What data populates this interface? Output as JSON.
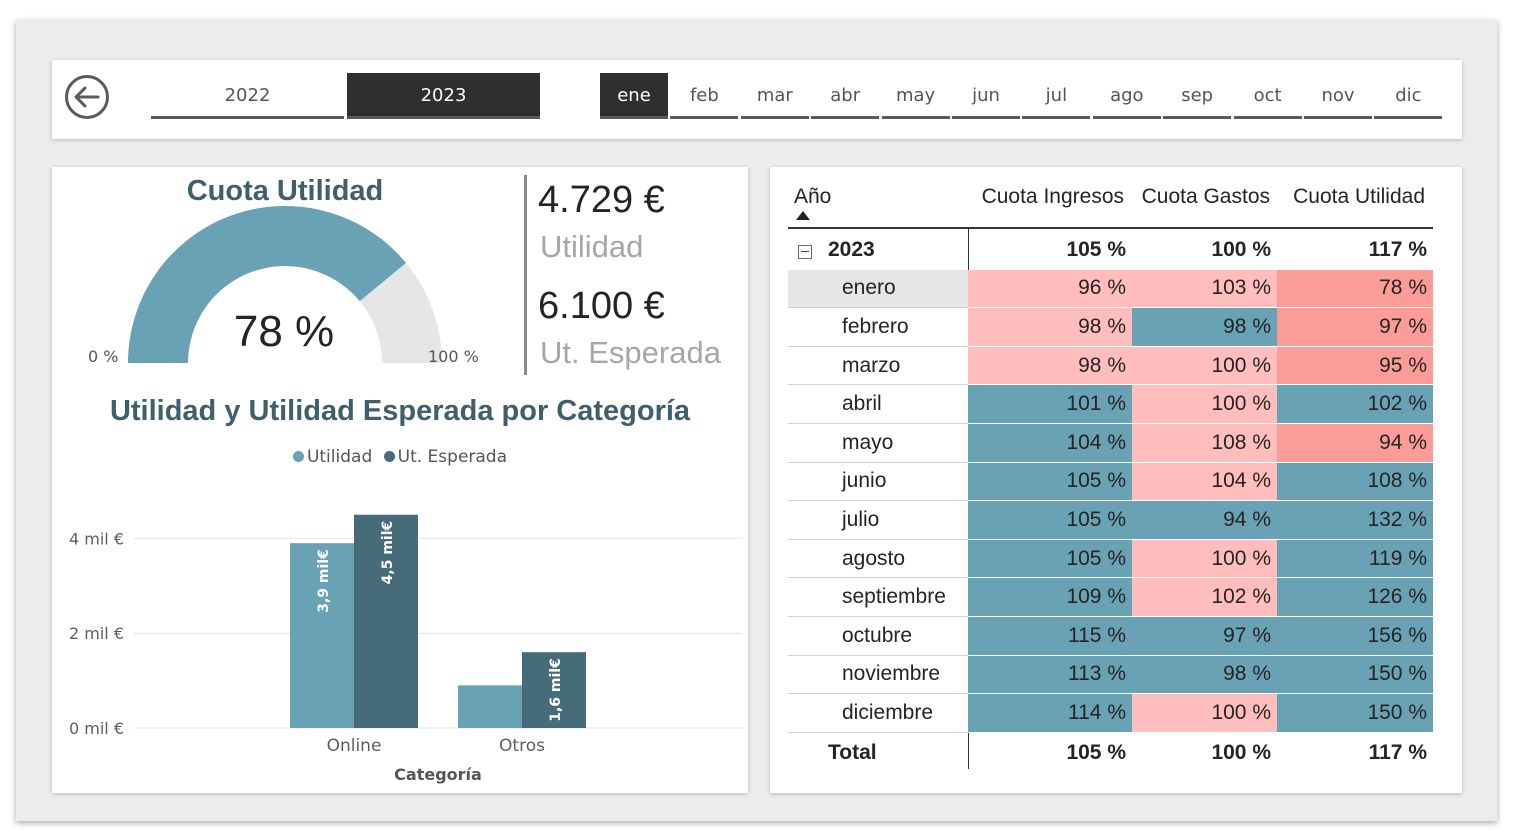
{
  "colors": {
    "teal": "#68a2b4",
    "dark_teal": "#476c79",
    "pink": "#ffbdbe",
    "red": "#fc9c99",
    "title": "#3f5f6c",
    "gauge_bg": "#e6e6e6",
    "selected": "#2f2f2f"
  },
  "filters": {
    "back_icon": "arrow-left-circle-icon",
    "years": [
      "2022",
      "2023"
    ],
    "selected_year": "2023",
    "months": [
      "ene",
      "feb",
      "mar",
      "abr",
      "may",
      "jun",
      "jul",
      "ago",
      "sep",
      "oct",
      "nov",
      "dic"
    ],
    "selected_month": "ene"
  },
  "gauge": {
    "title": "Cuota Utilidad",
    "value": 0.78,
    "value_label": "78 %",
    "min_label": "0 %",
    "max_label": "100 %"
  },
  "kpis": [
    {
      "value": "4.729 €",
      "label": "Utilidad"
    },
    {
      "value": "6.100 €",
      "label": "Ut. Esperada"
    }
  ],
  "chart_data": {
    "type": "bar",
    "title": "Utilidad y Utilidad Esperada por Categoría",
    "xlabel": "Categoría",
    "ylabel": "",
    "categories": [
      "Online",
      "Otros"
    ],
    "series": [
      {
        "name": "Utilidad",
        "values": [
          3.9,
          0.9
        ],
        "labels": [
          "3,9 mil€",
          ""
        ]
      },
      {
        "name": "Ut. Esperada",
        "values": [
          4.5,
          1.6
        ],
        "labels": [
          "4,5 mil€",
          "1,6 mil€"
        ]
      }
    ],
    "yticks": [
      0,
      2,
      4
    ],
    "ytick_labels": [
      "0 mil €",
      "2 mil €",
      "4 mil €"
    ],
    "ylim": [
      0,
      4.6
    ],
    "grid": true,
    "legend": "top-center"
  },
  "matrix": {
    "header": {
      "year": "Año",
      "c1": "Cuota Ingresos",
      "c2": "Cuota Gastos",
      "c3": "Cuota Utilidad"
    },
    "year_row": {
      "label": "2023",
      "c1": "105 %",
      "c2": "100 %",
      "c3": "117 %"
    },
    "rows": [
      {
        "label": "enero",
        "c1": "96 %",
        "c2": "103 %",
        "c3": "78 %",
        "k1": "pink",
        "k2": "pink",
        "k3": "red"
      },
      {
        "label": "febrero",
        "c1": "98 %",
        "c2": "98 %",
        "c3": "97 %",
        "k1": "pink",
        "k2": "teal",
        "k3": "red"
      },
      {
        "label": "marzo",
        "c1": "98 %",
        "c2": "100 %",
        "c3": "95 %",
        "k1": "pink",
        "k2": "pink",
        "k3": "red"
      },
      {
        "label": "abril",
        "c1": "101 %",
        "c2": "100 %",
        "c3": "102 %",
        "k1": "teal",
        "k2": "pink",
        "k3": "teal"
      },
      {
        "label": "mayo",
        "c1": "104 %",
        "c2": "108 %",
        "c3": "94 %",
        "k1": "teal",
        "k2": "pink",
        "k3": "red"
      },
      {
        "label": "junio",
        "c1": "105 %",
        "c2": "104 %",
        "c3": "108 %",
        "k1": "teal",
        "k2": "pink",
        "k3": "teal"
      },
      {
        "label": "julio",
        "c1": "105 %",
        "c2": "94 %",
        "c3": "132 %",
        "k1": "teal",
        "k2": "teal",
        "k3": "teal"
      },
      {
        "label": "agosto",
        "c1": "105 %",
        "c2": "100 %",
        "c3": "119 %",
        "k1": "teal",
        "k2": "pink",
        "k3": "teal"
      },
      {
        "label": "septiembre",
        "c1": "109 %",
        "c2": "102 %",
        "c3": "126 %",
        "k1": "teal",
        "k2": "pink",
        "k3": "teal"
      },
      {
        "label": "octubre",
        "c1": "115 %",
        "c2": "97 %",
        "c3": "156 %",
        "k1": "teal",
        "k2": "teal",
        "k3": "teal"
      },
      {
        "label": "noviembre",
        "c1": "113 %",
        "c2": "98 %",
        "c3": "150 %",
        "k1": "teal",
        "k2": "teal",
        "k3": "teal"
      },
      {
        "label": "diciembre",
        "c1": "114 %",
        "c2": "100 %",
        "c3": "150 %",
        "k1": "teal",
        "k2": "pink",
        "k3": "teal"
      }
    ],
    "total_row": {
      "label": "Total",
      "c1": "105 %",
      "c2": "100 %",
      "c3": "117 %"
    }
  }
}
